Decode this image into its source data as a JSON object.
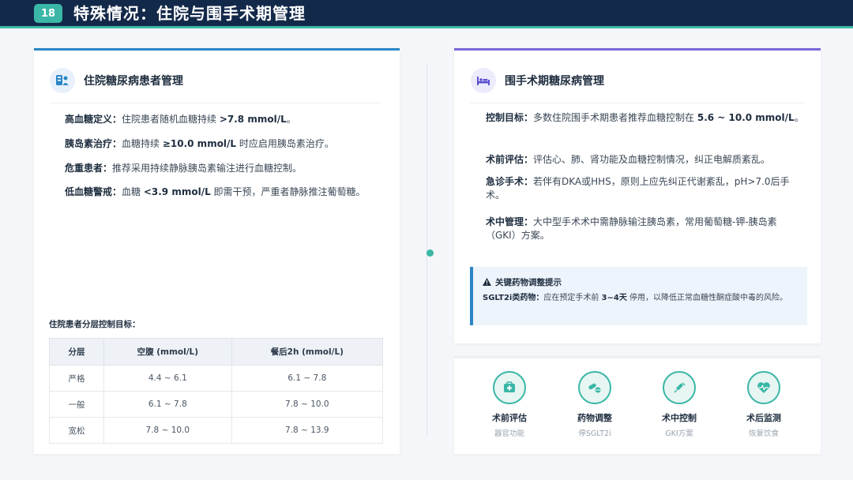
{
  "header": {
    "page_number": "18",
    "title": "特殊情况：住院与围手术期管理",
    "colors": {
      "bar": "#13294a",
      "accent": "#3ab7a6"
    }
  },
  "left_card": {
    "title": "住院糖尿病患者管理",
    "icon": "hospital-patient-icon",
    "rows": [
      {
        "label": "高血糖定义：",
        "pre": "住院患者随机血糖持续 ",
        "bold": ">7.8 mmol/L",
        "post": "。"
      },
      {
        "label": "胰岛素治疗：",
        "pre": "血糖持续 ",
        "bold": "≥10.0 mmol/L",
        "post": " 时应启用胰岛素治疗。"
      },
      {
        "label": "危重患者：",
        "pre": "推荐采用持续静脉胰岛素输注进行血糖控制。",
        "bold": "",
        "post": ""
      },
      {
        "label": "低血糖警戒：",
        "pre": "血糖 ",
        "bold": "<3.9 mmol/L",
        "post": " 即需干预，严重者静脉推注葡萄糖。"
      }
    ],
    "table": {
      "caption": "住院患者分层控制目标：",
      "headers": [
        "分层",
        "空腹 (mmol/L)",
        "餐后2h (mmol/L)"
      ],
      "rows": [
        [
          "严格",
          "4.4 ~ 6.1",
          "6.1 ~ 7.8"
        ],
        [
          "一般",
          "6.1 ~ 7.8",
          "7.8 ~ 10.0"
        ],
        [
          "宽松",
          "7.8 ~ 10.0",
          "7.8 ~ 13.9"
        ]
      ]
    }
  },
  "right_card": {
    "title": "围手术期糖尿病管理",
    "icon": "surgery-bed-icon",
    "rows": [
      {
        "label": "控制目标：",
        "pre": "多数住院围手术期患者推荐血糖控制在 ",
        "bold": "5.6 ~ 10.0 mmol/L",
        "post": "。"
      },
      {
        "label": "术前评估：",
        "pre": "评估心、肺、肾功能及血糖控制情况，纠正电解质紊乱。",
        "bold": "",
        "post": ""
      },
      {
        "label": "急诊手术：",
        "pre": "若伴有DKA或HHS，原则上应先纠正代谢紊乱，pH>7.0后手术。",
        "bold": "",
        "post": ""
      },
      {
        "label": "术中管理：",
        "pre": "大中型手术术中需静脉输注胰岛素，常用葡萄糖-钾-胰岛素（GKI）方案。",
        "bold": "",
        "post": ""
      }
    ],
    "alert": {
      "icon": "warning-icon",
      "title": "关键药物调整提示",
      "label": "SGLT2i类药物：",
      "pre": "应在预定手术前 ",
      "bold": "3~4天",
      "post": " 停用，以降低正常血糖性酮症酸中毒的风险。"
    }
  },
  "steps": [
    {
      "icon": "medical-kit-icon",
      "label": "术前评估",
      "sub": "器官功能"
    },
    {
      "icon": "pills-icon",
      "label": "药物调整",
      "sub": "停SGLT2i"
    },
    {
      "icon": "syringe-icon",
      "label": "术中控制",
      "sub": "GKI方案"
    },
    {
      "icon": "heart-monitor-icon",
      "label": "术后监测",
      "sub": "恢复饮食"
    }
  ]
}
